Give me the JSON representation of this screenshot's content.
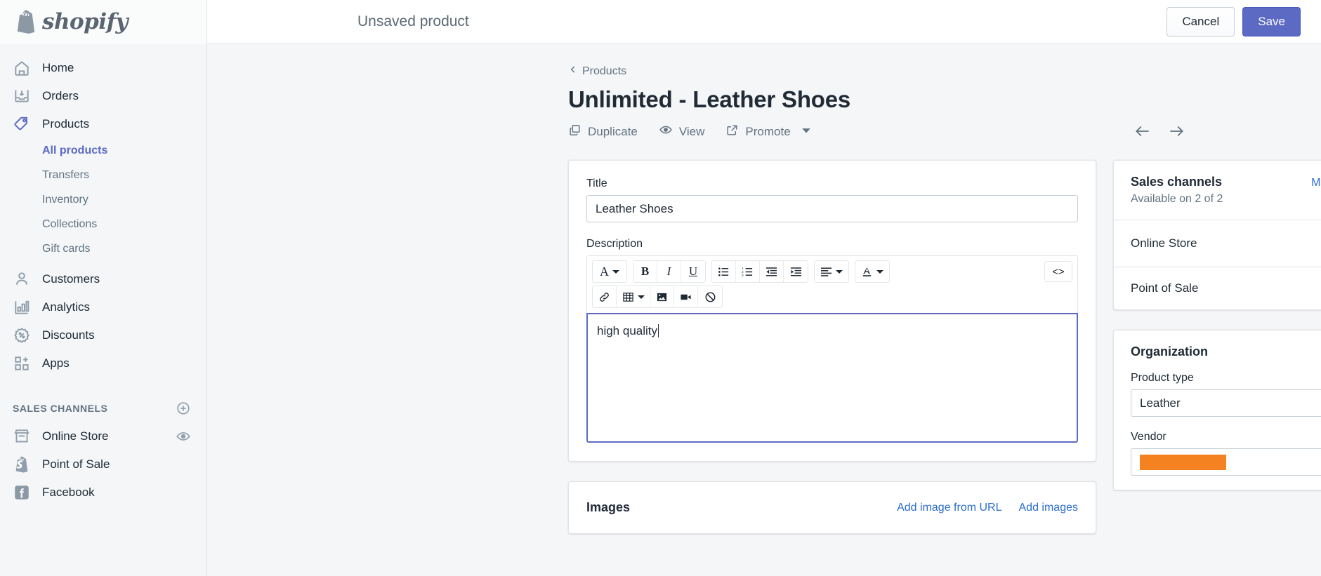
{
  "colors": {
    "brand_purple": "#5c6ac4",
    "link_blue": "#2c6ecb",
    "redaction_orange": "#f58220",
    "sidebar_bg": "#f4f6f8",
    "text_dark": "#212b36",
    "text_muted": "#637381"
  },
  "topbar": {
    "logo_word": "shopify",
    "logo_icon": "shopify-bag-icon",
    "title": "Unsaved product",
    "cancel_label": "Cancel",
    "save_label": "Save"
  },
  "sidebar": {
    "items": [
      {
        "label": "Home",
        "icon": "home-icon"
      },
      {
        "label": "Orders",
        "icon": "orders-inbox-icon"
      },
      {
        "label": "Products",
        "icon": "products-tag-icon"
      }
    ],
    "product_subitems": [
      {
        "label": "All products",
        "active": true
      },
      {
        "label": "Transfers",
        "active": false
      },
      {
        "label": "Inventory",
        "active": false
      },
      {
        "label": "Collections",
        "active": false
      },
      {
        "label": "Gift cards",
        "active": false
      }
    ],
    "items2": [
      {
        "label": "Customers",
        "icon": "customer-person-icon"
      },
      {
        "label": "Analytics",
        "icon": "analytics-bars-icon"
      },
      {
        "label": "Discounts",
        "icon": "discount-percent-icon"
      },
      {
        "label": "Apps",
        "icon": "apps-grid-plus-icon"
      }
    ],
    "sales_channels_heading": "SALES CHANNELS",
    "sales_channels_add_icon": "plus-circle-icon",
    "channels": [
      {
        "label": "Online Store",
        "icon": "storefront-icon",
        "trailing_icon": "eye-icon"
      },
      {
        "label": "Point of Sale",
        "icon": "shopify-bag-icon",
        "trailing_icon": ""
      },
      {
        "label": "Facebook",
        "icon": "facebook-icon",
        "trailing_icon": ""
      }
    ]
  },
  "page": {
    "breadcrumb_label": "Products",
    "breadcrumb_icon": "chevron-left-icon",
    "title": "Unlimited - Leather Shoes",
    "actions": [
      {
        "label": "Duplicate",
        "icon": "duplicate-icon",
        "has_caret": false
      },
      {
        "label": "View",
        "icon": "eye-icon",
        "has_caret": false
      },
      {
        "label": "Promote",
        "icon": "external-link-icon",
        "has_caret": true
      }
    ],
    "prev_icon": "arrow-left-icon",
    "next_icon": "arrow-right-icon"
  },
  "product_form": {
    "title_label": "Title",
    "title_value": "Leather Shoes",
    "title_placeholder": "",
    "description_label": "Description",
    "description_value": "high quality",
    "editor_toolbar_row1": [
      {
        "name": "format-style-button",
        "glyph": "A",
        "caret": true
      },
      {
        "name": "bold-button",
        "glyph": "B",
        "caret": false
      },
      {
        "name": "italic-button",
        "glyph": "I",
        "caret": false
      },
      {
        "name": "underline-button",
        "glyph": "U",
        "caret": false
      },
      {
        "name": "bulleted-list-button",
        "glyph": "list-bullet-icon",
        "caret": false
      },
      {
        "name": "numbered-list-button",
        "glyph": "list-number-icon",
        "caret": false
      },
      {
        "name": "outdent-button",
        "glyph": "outdent-icon",
        "caret": false
      },
      {
        "name": "indent-button",
        "glyph": "indent-icon",
        "caret": false
      },
      {
        "name": "align-button",
        "glyph": "align-left-icon",
        "caret": true
      },
      {
        "name": "text-color-button",
        "glyph": "text-color-icon",
        "caret": true
      }
    ],
    "editor_toolbar_row2": [
      {
        "name": "insert-link-button",
        "glyph": "link-icon",
        "caret": false
      },
      {
        "name": "insert-table-button",
        "glyph": "table-icon",
        "caret": true
      },
      {
        "name": "insert-image-button",
        "glyph": "image-icon",
        "caret": false
      },
      {
        "name": "insert-video-button",
        "glyph": "video-icon",
        "caret": false
      },
      {
        "name": "clear-formatting-button",
        "glyph": "no-formatting-icon",
        "caret": false
      }
    ],
    "code_view_label": "<>"
  },
  "sales_channels_card": {
    "title": "Sales channels",
    "manage_label": "Manage",
    "availability": "Available on 2 of 2",
    "rows": [
      {
        "name": "Online Store",
        "trailing_icon": "calendar-icon"
      },
      {
        "name": "Point of Sale",
        "trailing_icon": ""
      }
    ]
  },
  "organization_card": {
    "title": "Organization",
    "product_type_label": "Product type",
    "product_type_value": "Leather",
    "vendor_label": "Vendor",
    "vendor_value": "",
    "vendor_redacted": true
  },
  "images_card": {
    "title": "Images",
    "add_from_url_label": "Add image from URL",
    "add_images_label": "Add images"
  }
}
